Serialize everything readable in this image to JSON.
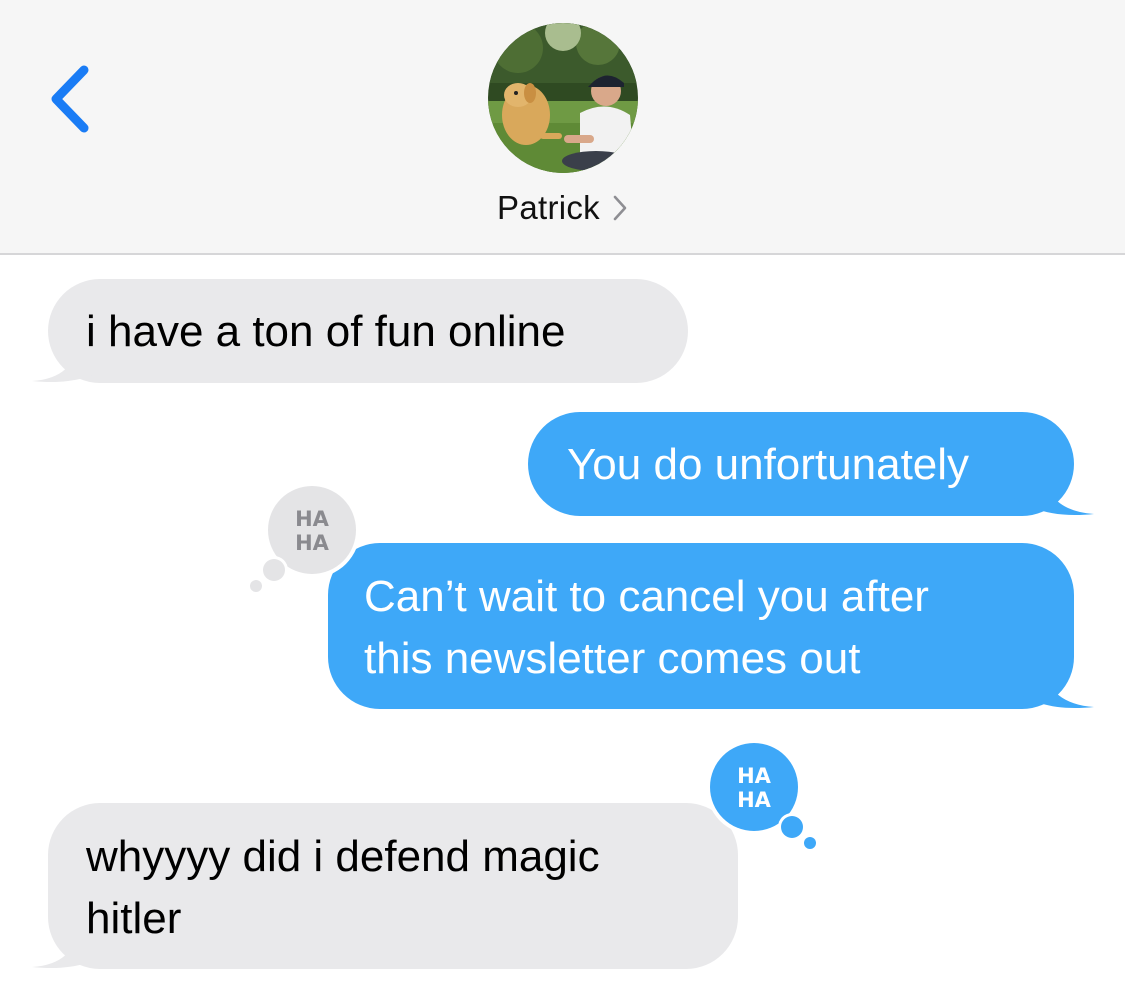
{
  "header": {
    "contact_name": "Patrick",
    "back_icon": "chevron-left-icon",
    "details_icon": "chevron-right-icon"
  },
  "messages": [
    {
      "direction": "incoming",
      "lines": [
        "i have a ton of fun online"
      ]
    },
    {
      "direction": "outgoing",
      "lines": [
        "You do unfortunately"
      ]
    },
    {
      "direction": "outgoing",
      "lines": [
        "Can’t wait to cancel you after",
        "this newsletter comes out"
      ],
      "tapback": {
        "icon": "haha-icon",
        "label_line1": "HA",
        "label_line2": "HA",
        "by": "contact"
      }
    },
    {
      "direction": "incoming",
      "lines": [
        "whyyyy did i defend magic",
        "hitler"
      ],
      "tapback": {
        "icon": "haha-icon",
        "label_line1": "HA",
        "label_line2": "HA",
        "by": "me"
      }
    }
  ],
  "colors": {
    "accent": "#1a7cf5",
    "outgoing_bubble": "#3ea8f8",
    "incoming_bubble": "#e9e9eb",
    "header_bg": "#f6f6f6",
    "tapback_gray": "#e4e4e6",
    "tapback_blue": "#3ea8f8"
  }
}
